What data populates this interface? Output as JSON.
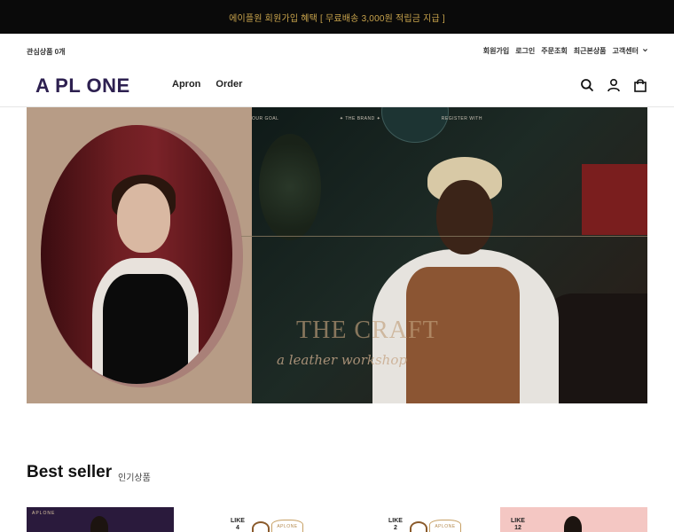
{
  "topbar": {
    "promo": "에이플원 회원가입 혜택 [ 무료배송 3,000원 적립금 지급 ]"
  },
  "util": {
    "wishlist": "관심상품 0개",
    "links": [
      "회원가입",
      "로그인",
      "주문조회",
      "최근본상품",
      "고객센터"
    ]
  },
  "header": {
    "logo": "A PL ONE",
    "nav": [
      "Apron",
      "Order"
    ],
    "icons": [
      "search-icon",
      "user-icon",
      "bag-icon"
    ]
  },
  "hero": {
    "tabs": [
      "OUR GOAL",
      "✦ THE BRAND ✦",
      "REGISTER WITH"
    ],
    "title": "THE CRAFT",
    "subtitle": "a leather workshop"
  },
  "best": {
    "title": "Best seller",
    "subtitle": "인기상품"
  },
  "products": [
    {
      "brand": "APLONE",
      "like_label": "",
      "like_count": ""
    },
    {
      "brand": "APLONE",
      "like_label": "LIKE",
      "like_count": "4"
    },
    {
      "brand": "APLONE",
      "like_label": "LIKE",
      "like_count": "2"
    },
    {
      "brand": "",
      "like_label": "LIKE",
      "like_count": "12"
    }
  ],
  "colors": {
    "topbar_bg": "#0a0a0a",
    "promo_text": "#c9a44c",
    "logo": "#2d2050"
  }
}
